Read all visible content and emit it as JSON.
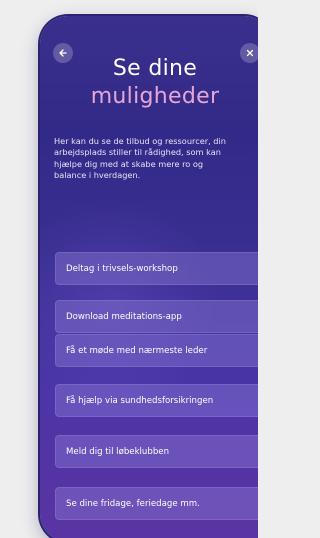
{
  "screen": {
    "title_line1": "Se dine",
    "title_line2": "muligheder",
    "intro_lines": [
      "Her kan du se de tilbud og ressourcer, din",
      "arbejdsplads stiller til rådighed, som kan",
      "hjælpe dig med at skabe mere ro og",
      "balance i hverdagen."
    ]
  },
  "nav": {
    "back_icon": "arrow-left-icon",
    "close_icon": "close-icon"
  },
  "options": [
    {
      "label": "Deltag i trivsels-workshop"
    },
    {
      "label": "Download meditations-app"
    },
    {
      "label": "Få et møde med nærmeste leder"
    },
    {
      "label": "Få hjælp via sundhedsforsikringen"
    },
    {
      "label": "Meld dig til løbeklubben"
    },
    {
      "label": "Se dine fridage, feriedage mm."
    }
  ],
  "colors": {
    "accent_title": "#e7a6d8",
    "background_top": "#3a2f8c",
    "background_bottom": "#4b2f9a",
    "button_fill": "#8c7dd7"
  }
}
